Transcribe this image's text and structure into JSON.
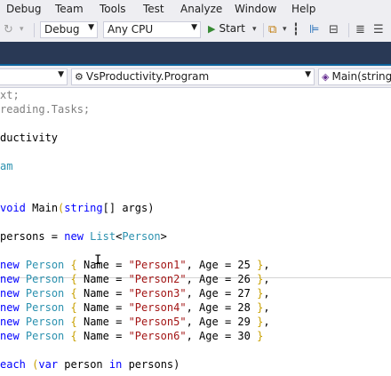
{
  "menu": [
    "Debug",
    "Team",
    "Tools",
    "Test",
    "Analyze",
    "Window",
    "Help"
  ],
  "toolbar": {
    "config": "Debug",
    "platform": "Any CPU",
    "start_label": "Start"
  },
  "navbar": {
    "class_selector": "VsProductivity.Program",
    "member_selector": "Main(string"
  },
  "code": {
    "line_context": "xt;",
    "line_tasks": "reading.Tasks;",
    "namespace_name": "ductivity",
    "class_name": "am",
    "main_void": "void",
    "main_name": "Main",
    "main_string": "string",
    "main_args": "[] args)",
    "persons_var": "persons = ",
    "persons_new": "new",
    "persons_list": "List",
    "persons_type": "Person",
    "rows": [
      {
        "new": "new",
        "type": "Person",
        "name_field": "Name = ",
        "name_val": "\"Person1\"",
        "age_field": ", Age = 25",
        "end": ","
      },
      {
        "new": "new",
        "type": "Person",
        "name_field": "Name = ",
        "name_val": "\"Person2\"",
        "age_field": ", Age = 26",
        "end": ","
      },
      {
        "new": "new",
        "type": "Person",
        "name_field": "Name = ",
        "name_val": "\"Person3\"",
        "age_field": ", Age = 27",
        "end": ","
      },
      {
        "new": "new",
        "type": "Person",
        "name_field": "Name = ",
        "name_val": "\"Person4\"",
        "age_field": ", Age = 28",
        "end": ","
      },
      {
        "new": "new",
        "type": "Person",
        "name_field": "Name = ",
        "name_val": "\"Person5\"",
        "age_field": ", Age = 29",
        "end": ","
      },
      {
        "new": "new",
        "type": "Person",
        "name_field": "Name = ",
        "name_val": "\"Person6\"",
        "age_field": ", Age = 30",
        "end": ""
      }
    ],
    "foreach_kw": "each",
    "foreach_var": "var",
    "foreach_item": "person",
    "foreach_in": "in",
    "foreach_coll": "persons)"
  },
  "colors": {
    "keyword": "#0000ff",
    "type": "#2b91af",
    "string": "#a31515",
    "tabstrip": "#293955",
    "chrome": "#eeeef2"
  }
}
